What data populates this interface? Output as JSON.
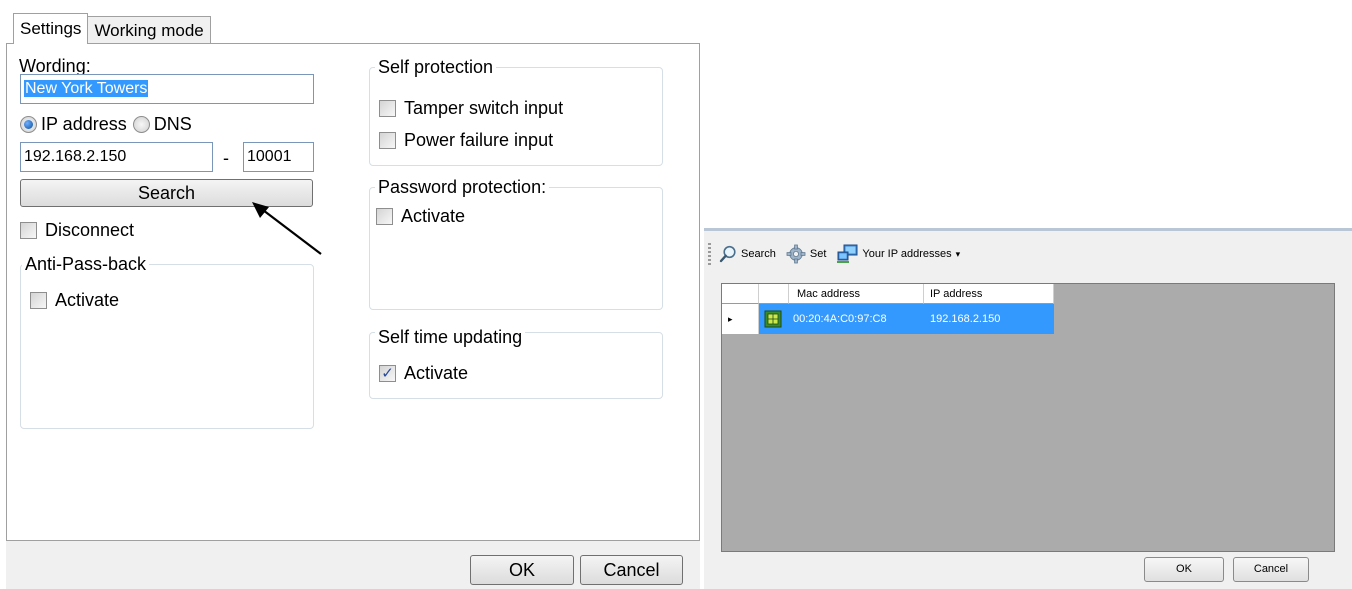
{
  "left_dialog": {
    "tabs": [
      {
        "label": "Settings",
        "active": true
      },
      {
        "label": "Working mode",
        "active": false
      }
    ],
    "wording": {
      "label": "Wording:",
      "value": "New York Towers"
    },
    "address_mode": {
      "ip_label": "IP address",
      "dns_label": "DNS",
      "selected": "IP address"
    },
    "ip": {
      "value": "192.168.2.150",
      "separator": "-",
      "port": "10001"
    },
    "search_button": "Search",
    "disconnect": {
      "label": "Disconnect",
      "checked": false
    },
    "anti_pass_back": {
      "title": "Anti-Pass-back",
      "activate_label": "Activate",
      "checked": false
    },
    "self_protection": {
      "title": "Self protection",
      "tamper_label": "Tamper switch input",
      "tamper_checked": false,
      "power_label": "Power failure input",
      "power_checked": false
    },
    "password_protection": {
      "title": "Password protection:",
      "activate_label": "Activate",
      "checked": false
    },
    "self_time_updating": {
      "title": "Self time updating",
      "activate_label": "Activate",
      "checked": true,
      "check_glyph": "✓"
    },
    "ok_button": "OK",
    "cancel_button": "Cancel"
  },
  "right_dialog": {
    "toolbar": {
      "search_label": "Search",
      "set_label": "Set",
      "ip_menu_label": "Your IP addresses",
      "ip_menu_arrow": "▾"
    },
    "grid": {
      "columns": [
        "Mac address",
        "IP address"
      ],
      "rows": [
        {
          "mac": "00:20:4A:C0:97:C8",
          "ip": "192.168.2.150",
          "selected": true,
          "indicator": "▸"
        }
      ]
    },
    "ok_button": "OK",
    "cancel_button": "Cancel"
  },
  "colors": {
    "selection": "#3399ff",
    "grid_background": "#ababab",
    "dialog_background": "#f0f0f0",
    "group_border": "#d5dfe5"
  }
}
